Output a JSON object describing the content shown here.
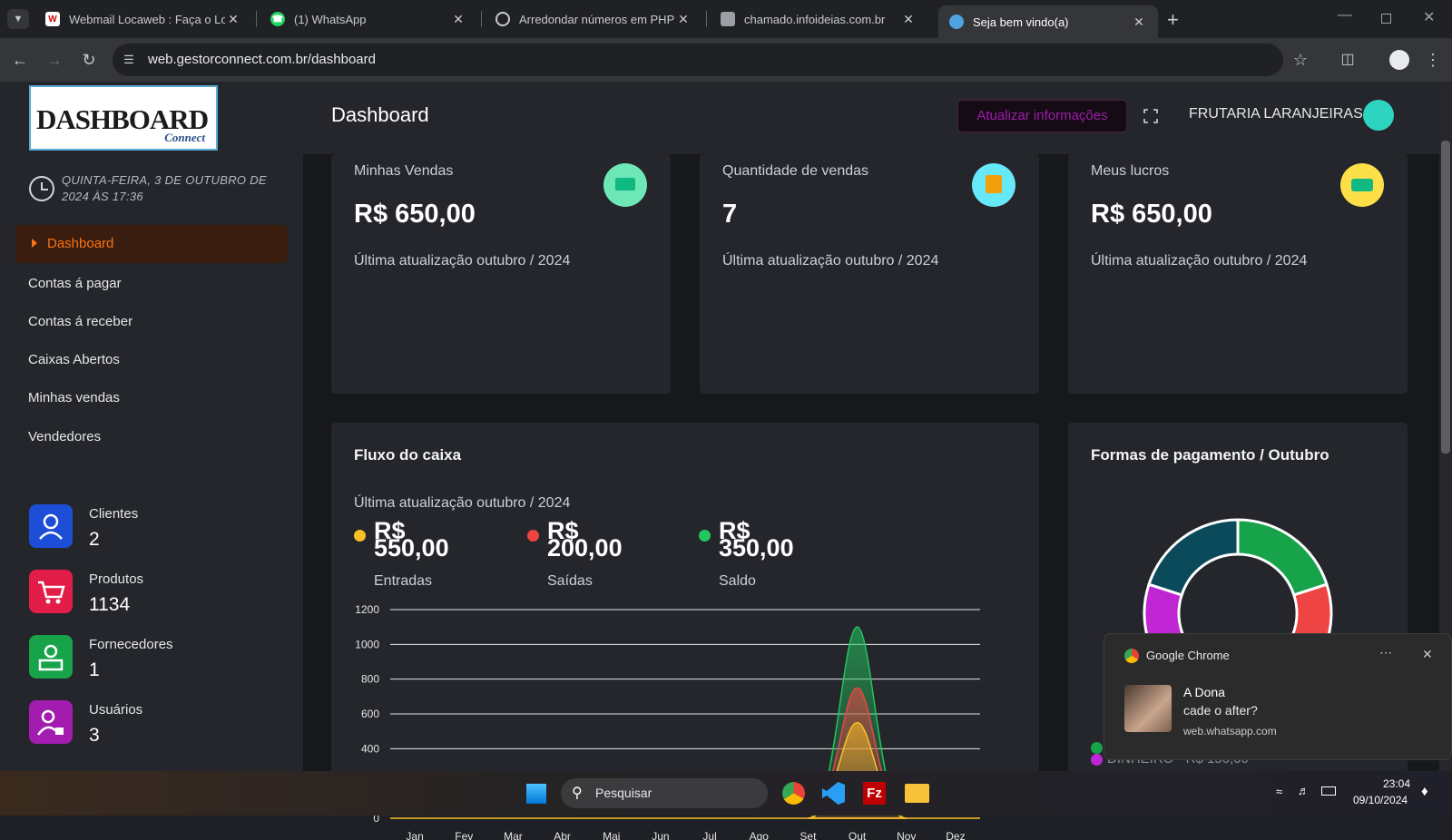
{
  "browser": {
    "tabs": [
      {
        "title": "Webmail Locaweb : Faça o Logi",
        "icon": "webmail-icon"
      },
      {
        "title": "(1) WhatsApp",
        "icon": "whatsapp-icon"
      },
      {
        "title": "Arredondar números em PHP",
        "icon": "openai-icon"
      },
      {
        "title": "chamado.infoideias.com.br",
        "icon": "site-icon"
      },
      {
        "title": "Seja bem vindo(a)",
        "icon": "site-icon",
        "active": true
      }
    ],
    "url": "web.gestorconnect.com.br/dashboard"
  },
  "sidebar": {
    "logo_main": "DASHBOARD",
    "logo_sub": "Connect",
    "datetime": "QUINTA-FEIRA, 3 DE OUTUBRO DE 2024 ÀS 17:36",
    "nav": [
      {
        "label": "Dashboard",
        "active": true
      },
      {
        "label": "Contas á pagar"
      },
      {
        "label": "Contas á receber"
      },
      {
        "label": "Caixas Abertos"
      },
      {
        "label": "Minhas vendas"
      },
      {
        "label": "Vendedores"
      }
    ],
    "stats": [
      {
        "title": "Clientes",
        "value": "2",
        "color": "#1d4ed8",
        "icon": "user-icon"
      },
      {
        "title": "Produtos",
        "value": "1134",
        "color": "#e11d48",
        "icon": "cart-icon"
      },
      {
        "title": "Fornecedores",
        "value": "1",
        "color": "#16a34a",
        "icon": "supplier-icon"
      },
      {
        "title": "Usuários",
        "value": "3",
        "color": "#a21caf",
        "icon": "user-lock-icon"
      }
    ]
  },
  "header": {
    "title": "Dashboard",
    "refresh_label": "Atualizar informações",
    "store_name": "FRUTARIA LARANJEIRAS"
  },
  "kpis": [
    {
      "title": "Minhas Vendas",
      "value": "R$ 650,00",
      "updated": "Última atualização outubro / 2024",
      "badge_color": "#6ee7b7",
      "icon": "money-icon"
    },
    {
      "title": "Quantidade de vendas",
      "value": "7",
      "updated": "Última atualização outubro / 2024",
      "badge_color": "#67e8f9",
      "icon": "box-icon"
    },
    {
      "title": "Meus lucros",
      "value": "R$ 650,00",
      "updated": "Última atualização outubro / 2024",
      "badge_color": "#fde047",
      "icon": "profit-icon"
    }
  ],
  "cashflow": {
    "title": "Fluxo do caixa",
    "updated": "Última atualização outubro / 2024",
    "legend": [
      {
        "value": "R$\n550,00",
        "label": "Entradas",
        "color": "#fbbf24"
      },
      {
        "value": "R$\n200,00",
        "label": "Saídas",
        "color": "#ef4444"
      },
      {
        "value": "R$\n350,00",
        "label": "Saldo",
        "color": "#22c55e"
      }
    ]
  },
  "chart_data": [
    {
      "type": "area",
      "ylim": [
        0,
        1200
      ],
      "yticks": [
        "0",
        "200",
        "400",
        "600",
        "800",
        "1000",
        "1200"
      ],
      "categories": [
        "Jan",
        "Fev",
        "Mar",
        "Abr",
        "Mai",
        "Jun",
        "Jul",
        "Ago",
        "Set",
        "Out",
        "Nov",
        "Dez"
      ],
      "series": [
        {
          "name": "Saldo",
          "color": "#22c55e",
          "values": [
            0,
            0,
            0,
            0,
            0,
            0,
            0,
            0,
            0,
            1100,
            0,
            0
          ]
        },
        {
          "name": "Saídas",
          "color": "#ef4444",
          "values": [
            0,
            0,
            0,
            0,
            0,
            0,
            0,
            0,
            0,
            750,
            0,
            0
          ]
        },
        {
          "name": "Entradas",
          "color": "#fbbf24",
          "values": [
            0,
            0,
            0,
            0,
            0,
            0,
            0,
            0,
            0,
            550,
            0,
            0
          ]
        }
      ]
    },
    {
      "type": "pie",
      "title": "Formas de pagamento / Outubro",
      "slices": [
        {
          "value": 20,
          "color": "#16a34a"
        },
        {
          "value": 22,
          "color": "#ef4444"
        },
        {
          "value": 38,
          "color": "#c026d3"
        },
        {
          "value": 20,
          "color": "#0b4a5a"
        }
      ],
      "legend_partial": "DINHEIRO - R$ 150,00"
    }
  ],
  "notification": {
    "app": "Google Chrome",
    "sender": "A Dona",
    "message": "cade o after?",
    "source": "web.whatsapp.com"
  },
  "taskbar": {
    "search_placeholder": "Pesquisar",
    "time": "23:04",
    "date": "09/10/2024"
  }
}
